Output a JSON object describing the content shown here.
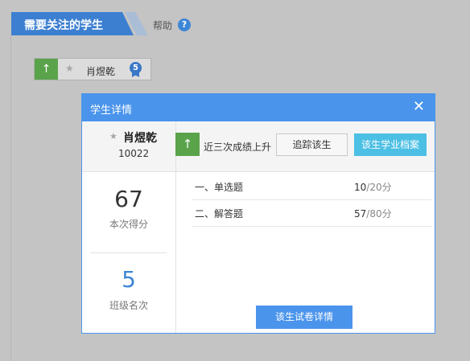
{
  "header": {
    "section_title": "需要关注的学生",
    "help_label": "帮助",
    "help_icon": "?"
  },
  "student_chip": {
    "trend_icon": "↑",
    "star_icon": "★",
    "name": "肖煜乾",
    "badge_value": "5"
  },
  "modal": {
    "title": "学生详情",
    "close_icon": "✕",
    "student": {
      "star_icon": "★",
      "name": "肖煜乾",
      "id": "10022"
    },
    "trend_icon": "↑",
    "trend_label": "近三次成绩上升",
    "track_button": "追踪该生",
    "archive_button": "该生学业档案",
    "score": {
      "value": "67",
      "label": "本次得分"
    },
    "rank": {
      "value": "5",
      "label": "班级名次"
    },
    "questions": [
      {
        "name": "一、单选题",
        "score": "10",
        "total": "/20分"
      },
      {
        "name": "二、解答题",
        "score": "57",
        "total": "/80分"
      }
    ],
    "detail_button": "该生试卷详情"
  },
  "colors": {
    "accent_blue": "#4a94ec",
    "trend_green": "#5aa34a",
    "archive_cyan": "#4cbfe4",
    "rank_blue": "#3c86d6"
  }
}
